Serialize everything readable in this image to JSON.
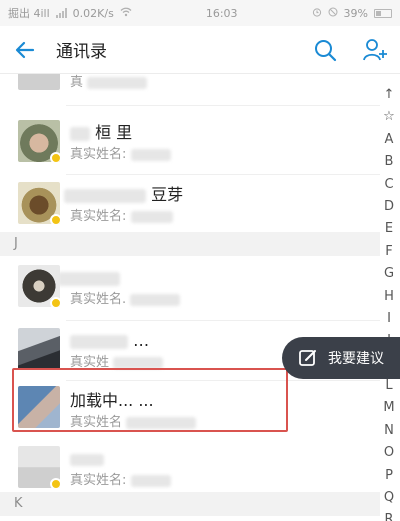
{
  "status_bar": {
    "carrier": "掘出 4ill",
    "speed": "0.02K/s",
    "time": "16:03",
    "battery": "39%"
  },
  "nav": {
    "title": "通讯录"
  },
  "contacts_top": [
    {
      "name": "",
      "sub_label": "真"
    },
    {
      "name": "桓 里",
      "sub_label": "真实姓名:"
    },
    {
      "name": "豆芽",
      "sub_label": "真实姓名:"
    }
  ],
  "section_j": "J",
  "contacts_j": [
    {
      "name": "",
      "sub_label": "真实姓名."
    },
    {
      "name": "…",
      "sub_label": "真实姓"
    },
    {
      "name": "加载中... ...",
      "sub_label": "真实姓名"
    },
    {
      "name": "",
      "sub_label": "真实姓名:"
    }
  ],
  "section_k": "K",
  "index_letters": [
    "↑",
    "☆",
    "A",
    "B",
    "C",
    "D",
    "E",
    "F",
    "G",
    "H",
    "I",
    "J",
    "K",
    "L",
    "M",
    "N",
    "O",
    "P",
    "Q",
    "R"
  ],
  "suggestion": {
    "label": "我要建议"
  },
  "colors": {
    "accent": "#1a8ad4",
    "highlight": "#d9534f",
    "badge": "#f3c414",
    "floating": "#3b4049"
  }
}
